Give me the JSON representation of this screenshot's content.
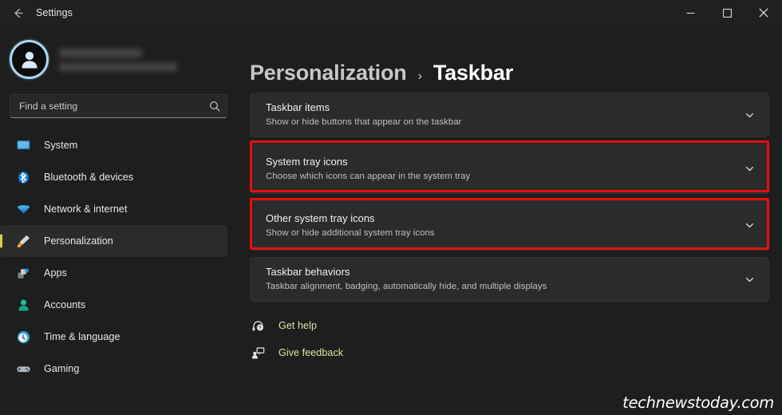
{
  "window": {
    "app_title": "Settings",
    "back_icon": "back-arrow-icon",
    "controls": {
      "minimize": "minimize-icon",
      "maximize": "maximize-icon",
      "close": "close-icon"
    }
  },
  "sidebar": {
    "account": {
      "avatar_icon": "user-avatar-icon",
      "name": "",
      "email": "",
      "redacted": true
    },
    "search": {
      "placeholder": "Find a setting",
      "value": "",
      "icon": "search-icon"
    },
    "items": [
      {
        "label": "System",
        "icon": "monitor-icon",
        "selected": false
      },
      {
        "label": "Bluetooth & devices",
        "icon": "bluetooth-icon",
        "selected": false
      },
      {
        "label": "Network & internet",
        "icon": "wifi-icon",
        "selected": false
      },
      {
        "label": "Personalization",
        "icon": "paintbrush-icon",
        "selected": true
      },
      {
        "label": "Apps",
        "icon": "apps-icon",
        "selected": false
      },
      {
        "label": "Accounts",
        "icon": "accounts-icon",
        "selected": false
      },
      {
        "label": "Time & language",
        "icon": "clock-icon",
        "selected": false
      },
      {
        "label": "Gaming",
        "icon": "gamepad-icon",
        "selected": false
      }
    ]
  },
  "main": {
    "breadcrumb": {
      "parent": "Personalization",
      "separator": "›",
      "current": "Taskbar"
    },
    "cards": [
      {
        "title": "Taskbar items",
        "subtitle": "Show or hide buttons that appear on the taskbar",
        "chevron": "chevron-down-icon",
        "highlighted": false
      },
      {
        "title": "System tray icons",
        "subtitle": "Choose which icons can appear in the system tray",
        "chevron": "chevron-down-icon",
        "highlighted": true
      },
      {
        "title": "Other system tray icons",
        "subtitle": "Show or hide additional system tray icons",
        "chevron": "chevron-down-icon",
        "highlighted": true
      },
      {
        "title": "Taskbar behaviors",
        "subtitle": "Taskbar alignment, badging, automatically hide, and multiple displays",
        "chevron": "chevron-down-icon",
        "highlighted": false
      }
    ],
    "footer_links": [
      {
        "label": "Get help",
        "icon": "help-headset-icon"
      },
      {
        "label": "Give feedback",
        "icon": "feedback-icon"
      }
    ]
  },
  "watermark": "technewstoday.com",
  "colors": {
    "window_bg": "#1e1e1e",
    "card_bg": "#2b2b2b",
    "highlight_red": "#e50f0f",
    "link_green": "#dbe6a4",
    "accent_bar": "#d4d24a",
    "avatar_ring": "#aad6f2"
  }
}
